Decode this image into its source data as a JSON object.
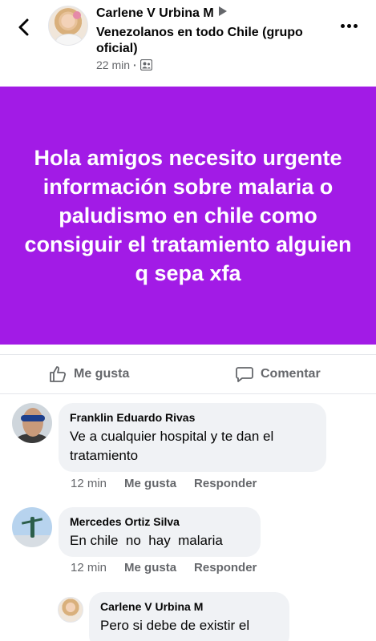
{
  "header": {
    "author": "Carlene V Urbina M",
    "group": "Venezolanos en todo Chile (grupo oficial)",
    "time": "22 min",
    "dot": "·"
  },
  "post": {
    "text": "Hola amigos necesito urgente información sobre malaria o paludismo en chile como consiguir el tratamiento alguien q sepa xfa",
    "background_color": "#a21be6"
  },
  "actions": {
    "like_label": "Me gusta",
    "comment_label": "Comentar"
  },
  "comments": [
    {
      "name": "Franklin Eduardo Rivas",
      "text": "Ve a cualquier hospital y te dan el tratamiento",
      "time": "12 min",
      "like": "Me gusta",
      "reply": "Responder"
    },
    {
      "name": "Mercedes Ortiz Silva",
      "text": "En chile  no  hay  malaria",
      "time": "12 min",
      "like": "Me gusta",
      "reply": "Responder"
    },
    {
      "name": "Carlene V Urbina M",
      "text": "Pero si debe de existir el"
    }
  ],
  "icons": {
    "back": "chevron-left-icon",
    "more": "more-horizontal-icon",
    "audience": "group-icon",
    "like": "thumbs-up-icon",
    "comment": "comment-bubble-icon"
  }
}
